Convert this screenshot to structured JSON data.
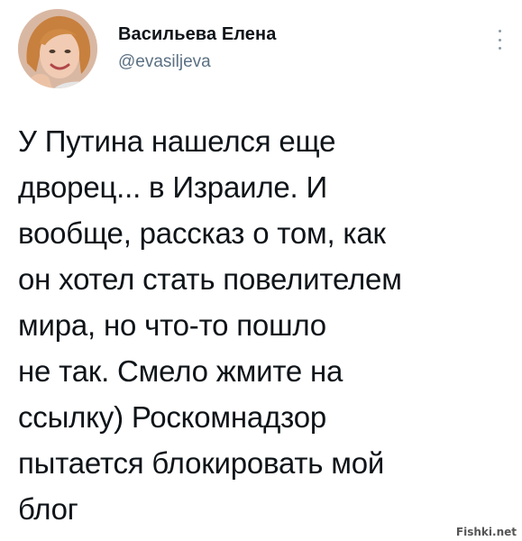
{
  "author": {
    "display_name": "Васильева Елена",
    "handle": "@evasiljeva"
  },
  "more_icon": "more-vertical-icon",
  "tweet": {
    "lines": [
      "У Путина нашелся еще",
      "дворец... в Израиле. И",
      "вообще, рассказ о том, как",
      "он хотел стать повелителем",
      "мира, но что-то пошло",
      "не так. Смело жмите на",
      "ссылку) Роскомнадзор",
      "пытается блокировать мой",
      "блог"
    ]
  },
  "watermark": "Fishki.net",
  "colors": {
    "text": "#0f1419",
    "handle": "#5b7083",
    "icon": "#8899a6"
  }
}
